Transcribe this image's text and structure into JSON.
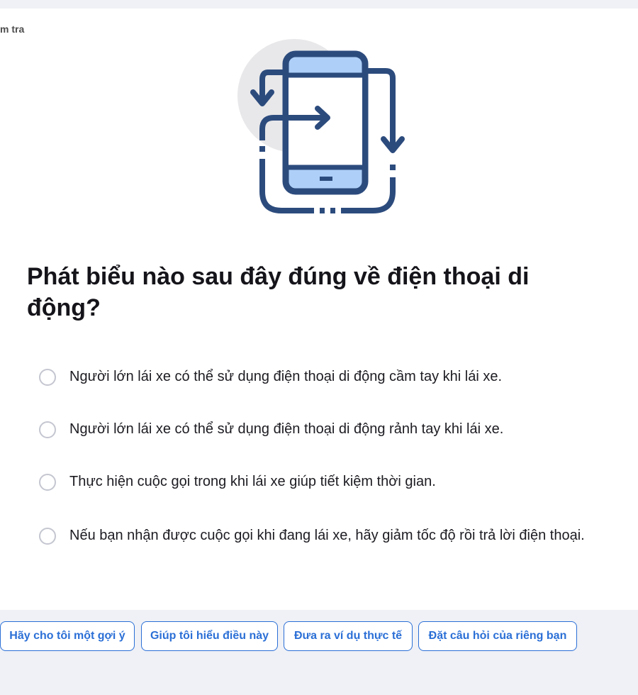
{
  "breadcrumb": {
    "text": "m tra"
  },
  "illustration": {
    "icon": "phone-with-swap-arrows-icon",
    "colors": {
      "stroke": "#2c4b7d",
      "screen": "#aed0f8",
      "circle": "#e8e8ea"
    }
  },
  "question": {
    "text": "Phát biểu nào sau đây đúng về điện thoại di động?"
  },
  "options": [
    {
      "label": "Người lớn lái xe có thể sử dụng điện thoại di động cầm tay khi lái xe."
    },
    {
      "label": "Người lớn lái xe có thể sử dụng điện thoại di động rảnh tay khi lái xe."
    },
    {
      "label": "Thực hiện cuộc gọi trong khi lái xe giúp tiết kiệm thời gian."
    },
    {
      "label": "Nếu bạn nhận được cuộc gọi khi đang lái xe, hãy giảm tốc độ rồi trả lời điện thoại."
    }
  ],
  "actions": [
    {
      "label": "Hãy cho tôi một gợi ý"
    },
    {
      "label": "Giúp tôi hiểu điều này"
    },
    {
      "label": "Đưa ra ví dụ thực tế"
    },
    {
      "label": "Đặt câu hỏi của riêng bạn"
    }
  ],
  "colors": {
    "accent": "#2b6fd6",
    "background": "#eff1f6",
    "card": "#ffffff"
  }
}
